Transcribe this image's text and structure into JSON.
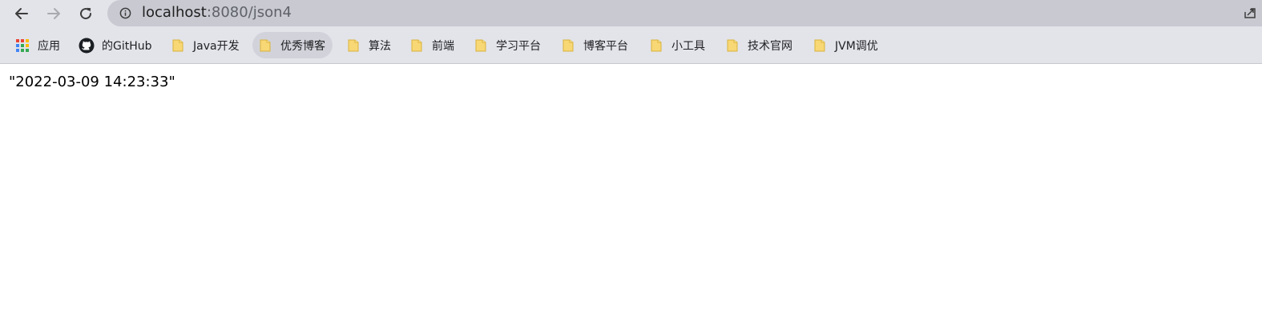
{
  "browser": {
    "url_host": "localhost",
    "url_rest": ":8080/json4",
    "nav": {
      "back_icon": "arrow-left-icon",
      "forward_icon": "arrow-right-icon",
      "reload_icon": "reload-icon"
    },
    "bookmarks": [
      {
        "label": "应用",
        "icon": "apps-grid-icon"
      },
      {
        "label": "的GitHub",
        "icon": "github-icon"
      },
      {
        "label": "Java开发",
        "icon": "folder-icon"
      },
      {
        "label": "优秀博客",
        "icon": "folder-icon"
      },
      {
        "label": "算法",
        "icon": "folder-icon"
      },
      {
        "label": "前端",
        "icon": "folder-icon"
      },
      {
        "label": "学习平台",
        "icon": "folder-icon"
      },
      {
        "label": "博客平台",
        "icon": "folder-icon"
      },
      {
        "label": "小工具",
        "icon": "folder-icon"
      },
      {
        "label": "技术官网",
        "icon": "folder-icon"
      },
      {
        "label": "JVM调优",
        "icon": "folder-icon"
      }
    ]
  },
  "page": {
    "body_text": "\"2022-03-09 14:23:33\""
  },
  "colors": {
    "toolbar_bg": "#e3e4ea",
    "omnibox_bg": "#c8c9d1",
    "folder_fill": "#f8d775"
  }
}
